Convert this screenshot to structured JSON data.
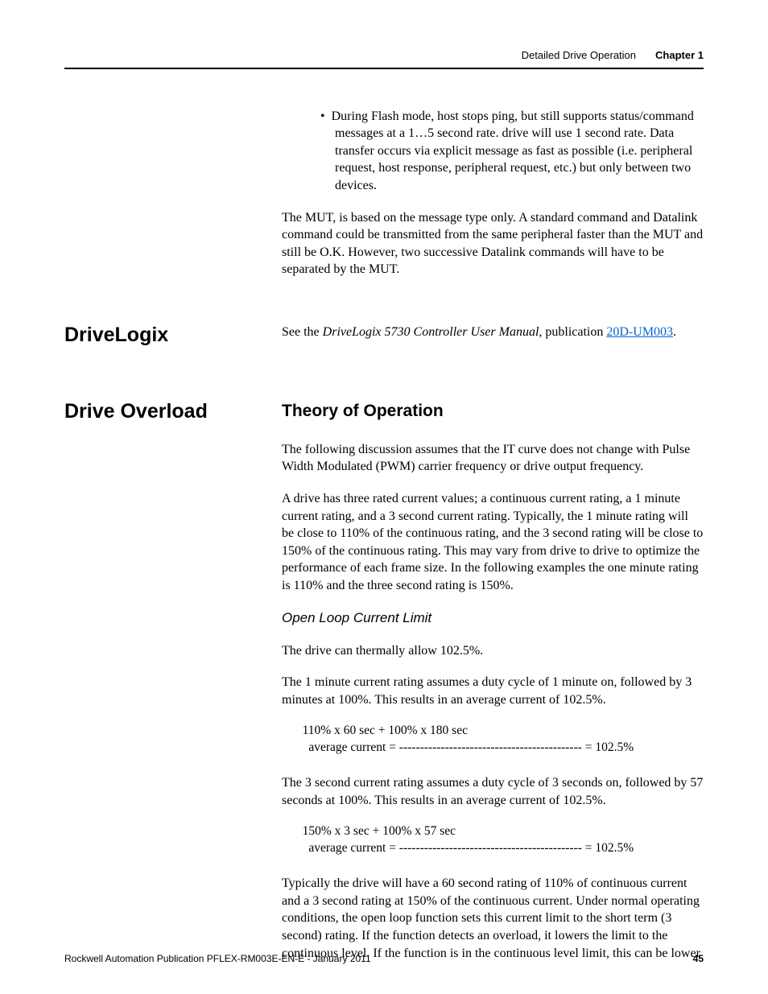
{
  "running_head": {
    "section_title": "Detailed Drive Operation",
    "chapter_label": "Chapter 1"
  },
  "intro": {
    "bullet_text": "During Flash mode, host stops ping, but still supports status/command messages at a 1…5 second rate. drive will use 1 second rate. Data transfer occurs via explicit message as fast as possible (i.e. peripheral request, host response, peripheral request, etc.) but only between two devices.",
    "mut_para": "The MUT, is based on the message type only. A standard command and Datalink command could be transmitted from the same peripheral faster than the MUT and still be O.K. However, two successive Datalink commands will have to be separated by the MUT."
  },
  "drivelogix": {
    "heading": "DriveLogix",
    "text_prefix": "See the ",
    "text_italic": "DriveLogix 5730 Controller User Manual",
    "text_mid": ", publication ",
    "pub_link": "20D-UM003",
    "text_suffix": "."
  },
  "drive_overload": {
    "heading": "Drive Overload",
    "theory_heading": "Theory of Operation",
    "theory_p1": "The following discussion assumes that the IT curve does not change with Pulse Width Modulated (PWM) carrier frequency or drive output frequency.",
    "theory_p2": "A drive has three rated current values; a continuous current rating, a 1 minute current rating, and a 3 second current rating. Typically, the 1 minute rating will be close to 110% of the continuous rating, and the 3 second rating will be close to 150% of the continuous rating. This may vary from drive to drive to optimize the performance of each frame size. In the following examples the one minute rating is 110% and the three second rating is 150%.",
    "open_loop_heading": "Open Loop Current Limit",
    "open_loop_p1": "The drive can thermally allow 102.5%.",
    "open_loop_p2": "The 1 minute current rating assumes a duty cycle of 1 minute on, followed by 3 minutes at 100%. This results in an average current of 102.5%.",
    "formula1": "   110% x 60 sec + 100% x 180 sec\n     average current = -------------------------------------------- = 102.5%",
    "open_loop_p3": "The 3 second current rating assumes a duty cycle of 3 seconds on, followed by 57 seconds at 100%. This results in an average current of 102.5%.",
    "formula2": "   150% x 3 sec + 100% x 57 sec\n     average current = -------------------------------------------- = 102.5%",
    "open_loop_p4": "Typically the drive will have a 60 second rating of 110% of continuous current and a 3 second rating at 150% of the continuous current. Under normal operating conditions, the open loop function sets this current limit to the short term (3 second) rating. If the function detects an overload, it lowers the limit to the continuous level. If the function is in the continuous level limit, this can be lower"
  },
  "footer": {
    "pub_line": "Rockwell Automation Publication PFLEX-RM003E-EN-E - January 2011",
    "page_number": "45"
  }
}
